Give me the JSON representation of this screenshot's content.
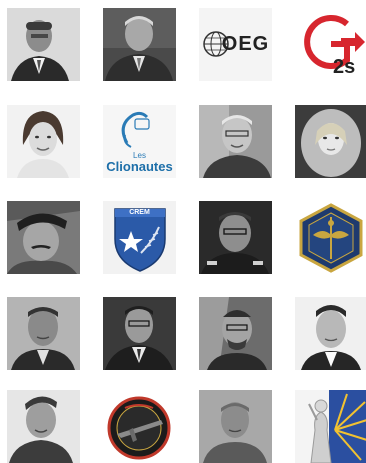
{
  "tiles": [
    {
      "label": "",
      "kind": "portrait"
    },
    {
      "label": "",
      "kind": "portrait"
    },
    {
      "label": "OEG",
      "kind": "logo"
    },
    {
      "label": "2s",
      "kind": "logo"
    },
    {
      "label": "",
      "kind": "portrait"
    },
    {
      "label_small": "Les",
      "label": "Clionautes",
      "kind": "logo"
    },
    {
      "label": "",
      "kind": "portrait"
    },
    {
      "label": "",
      "kind": "portrait"
    },
    {
      "label": "",
      "kind": "portrait"
    },
    {
      "label": "CREM",
      "kind": "logo"
    },
    {
      "label": "",
      "kind": "portrait"
    },
    {
      "label": "",
      "kind": "logo"
    },
    {
      "label": "",
      "kind": "portrait"
    },
    {
      "label": "",
      "kind": "portrait"
    },
    {
      "label": "",
      "kind": "portrait"
    },
    {
      "label": "",
      "kind": "portrait"
    },
    {
      "label": "",
      "kind": "portrait"
    },
    {
      "label": "",
      "kind": "logo"
    },
    {
      "label": "",
      "kind": "portrait"
    },
    {
      "label": "",
      "kind": "logo"
    }
  ],
  "colors": {
    "g2s_red": "#d7262e",
    "clionautes_blue": "#2a7bb6",
    "crem_blue": "#2b5aa8",
    "badge_gold": "#c9a640"
  }
}
